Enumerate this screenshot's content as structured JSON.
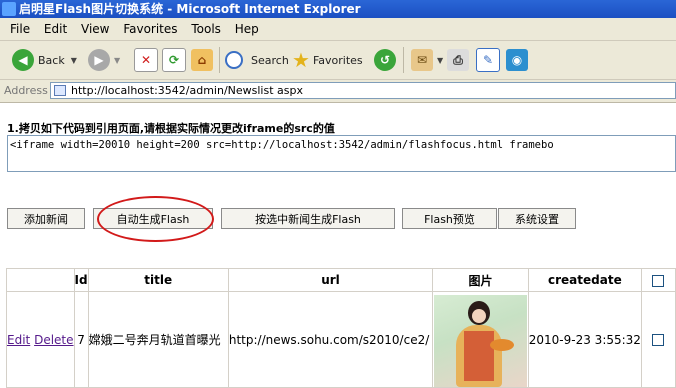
{
  "window": {
    "title": "启明星Flash图片切换系统 - Microsoft Internet Explorer"
  },
  "menu": {
    "items": [
      "File",
      "Edit",
      "View",
      "Favorites",
      "Tools",
      "Hep"
    ]
  },
  "toolbar": {
    "back_label": "Back",
    "search_label": "Search",
    "favorites_label": "Favorites"
  },
  "address": {
    "label": "Address",
    "url": "http://localhost:3542/admin/Newslist aspx"
  },
  "page": {
    "instruction": "1.拷贝如下代码到引用页面,请根据实际情况更改iframe的src的值",
    "code": "<iframe width=20010 height=200 src=http://localhost:3542/admin/flashfocus.html   framebo"
  },
  "buttons": {
    "add_news": "添加新闻",
    "auto_gen": "自动生成Flash",
    "gen_selected": "按选中新闻生成Flash",
    "preview": "Flash预览",
    "settings": "系统设置"
  },
  "table": {
    "headers": [
      "",
      "Id",
      "title",
      "url",
      "图片",
      "createdate"
    ],
    "rows": [
      {
        "edit": "Edit",
        "delete": "Delete",
        "id": "7",
        "title": "嫦娥二号奔月轨道首曝光",
        "url": "http://news.sohu.com/s2010/ce2/",
        "createdate": "2010-9-23 3:55:32"
      }
    ]
  }
}
